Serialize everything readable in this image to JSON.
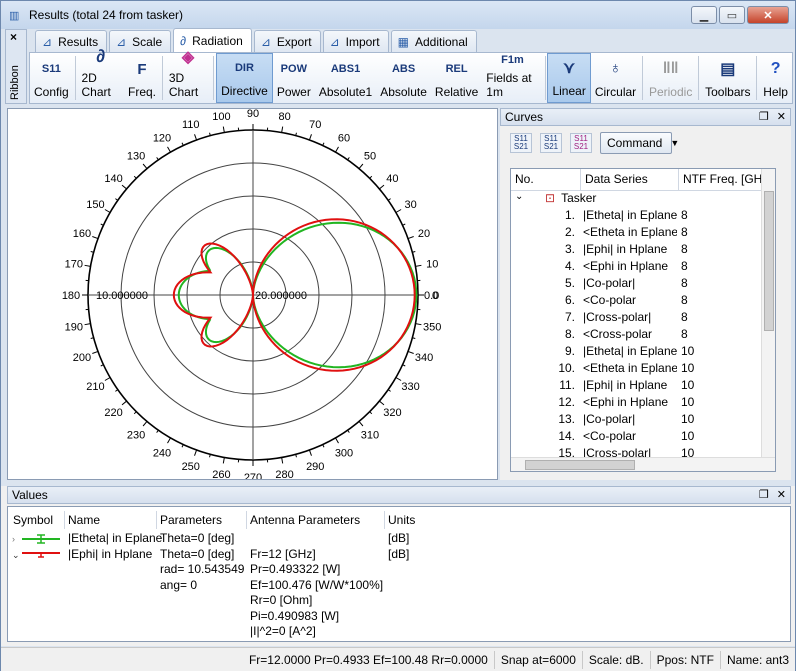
{
  "window": {
    "title": "Results (total 24 from tasker)"
  },
  "ribbon_side": {
    "close": "×",
    "label": "Ribbon"
  },
  "tabs": [
    {
      "label": "Results",
      "icon": "results-chart-icon"
    },
    {
      "label": "Scale",
      "icon": "scale-chart-icon"
    },
    {
      "label": "Radiation",
      "icon": "radiation-icon",
      "active": true
    },
    {
      "label": "Export",
      "icon": "export-icon"
    },
    {
      "label": "Import",
      "icon": "import-icon"
    },
    {
      "label": "Additional",
      "icon": "additional-icon"
    }
  ],
  "ribbon": {
    "config": "Config",
    "chart2d": "2D Chart",
    "freq": "Freq.",
    "chart3d": "3D Chart",
    "directive": "Directive",
    "directive_ic": "DIR",
    "power": "Power",
    "power_ic": "POW",
    "absolute1": "Absolute1",
    "absolute1_ic": "ABS1",
    "absolute": "Absolute",
    "absolute_ic": "ABS",
    "relative": "Relative",
    "relative_ic": "REL",
    "fields": "Fields at 1m",
    "fields_ic": "F1m",
    "linear": "Linear",
    "circular": "Circular",
    "periodic": "Periodic",
    "toolbars": "Toolbars",
    "help": "Help"
  },
  "chart": {
    "center_label": "20.000000",
    "left_label": "10.000000",
    "right_label": "0.0",
    "angles": [
      "0",
      "10",
      "20",
      "30",
      "40",
      "50",
      "60",
      "70",
      "80",
      "90",
      "100",
      "110",
      "120",
      "130",
      "140",
      "150",
      "160",
      "170",
      "180",
      "190",
      "200",
      "210",
      "220",
      "230",
      "240",
      "250",
      "260",
      "270",
      "280",
      "290",
      "300",
      "310",
      "320",
      "330",
      "340",
      "350"
    ],
    "green": "#22b522",
    "red": "#e01010"
  },
  "curves": {
    "title": "Curves",
    "command": "Command",
    "headers": [
      "No.",
      "Data Series",
      "NTF Freq. [GHz]"
    ],
    "folder": "Tasker",
    "rows": [
      [
        "1.",
        "|Etheta| in Eplane",
        "8"
      ],
      [
        "2.",
        "<Etheta in Eplane",
        "8"
      ],
      [
        "3.",
        "|Ephi| in Hplane",
        "8"
      ],
      [
        "4.",
        "<Ephi in Hplane",
        "8"
      ],
      [
        "5.",
        "|Co-polar|",
        "8"
      ],
      [
        "6.",
        "<Co-polar",
        "8"
      ],
      [
        "7.",
        "|Cross-polar|",
        "8"
      ],
      [
        "8.",
        "<Cross-polar",
        "8"
      ],
      [
        "9.",
        "|Etheta| in Eplane",
        "10"
      ],
      [
        "10.",
        "<Etheta in Eplane",
        "10"
      ],
      [
        "11.",
        "|Ephi| in Hplane",
        "10"
      ],
      [
        "12.",
        "<Ephi in Hplane",
        "10"
      ],
      [
        "13.",
        "|Co-polar|",
        "10"
      ],
      [
        "14.",
        "<Co-polar",
        "10"
      ],
      [
        "15.",
        "|Cross-polar|",
        "10"
      ]
    ]
  },
  "values": {
    "title": "Values",
    "headers": {
      "symbol": "Symbol",
      "name": "Name",
      "parameters": "Parameters",
      "antenna": "Antenna Parameters",
      "units": "Units"
    },
    "rows": [
      {
        "name": "|Etheta| in Eplane",
        "param": "Theta=0 [deg]",
        "units": "[dB]"
      },
      {
        "name": "|Ephi| in Hplane",
        "param": "Theta=0 [deg]",
        "units": "[dB]"
      }
    ],
    "extra_params": [
      "rad= 10.543549",
      "ang= 0"
    ],
    "antenna": [
      "Fr=12 [GHz]",
      "Pr=0.493322 [W]",
      "Ef=100.476 [W/W*100%]",
      "Rr=0 [Ohm]",
      "Pi=0.490983 [W]",
      "|I|^2=0 [A^2]"
    ]
  },
  "status": {
    "main": "Fr=12.0000 Pr=0.4933 Ef=100.48 Rr=0.0000",
    "snap": "Snap at=6000",
    "scale": "Scale: dB.",
    "ppos": "Ppos: NTF",
    "name": "Name: ant3"
  }
}
